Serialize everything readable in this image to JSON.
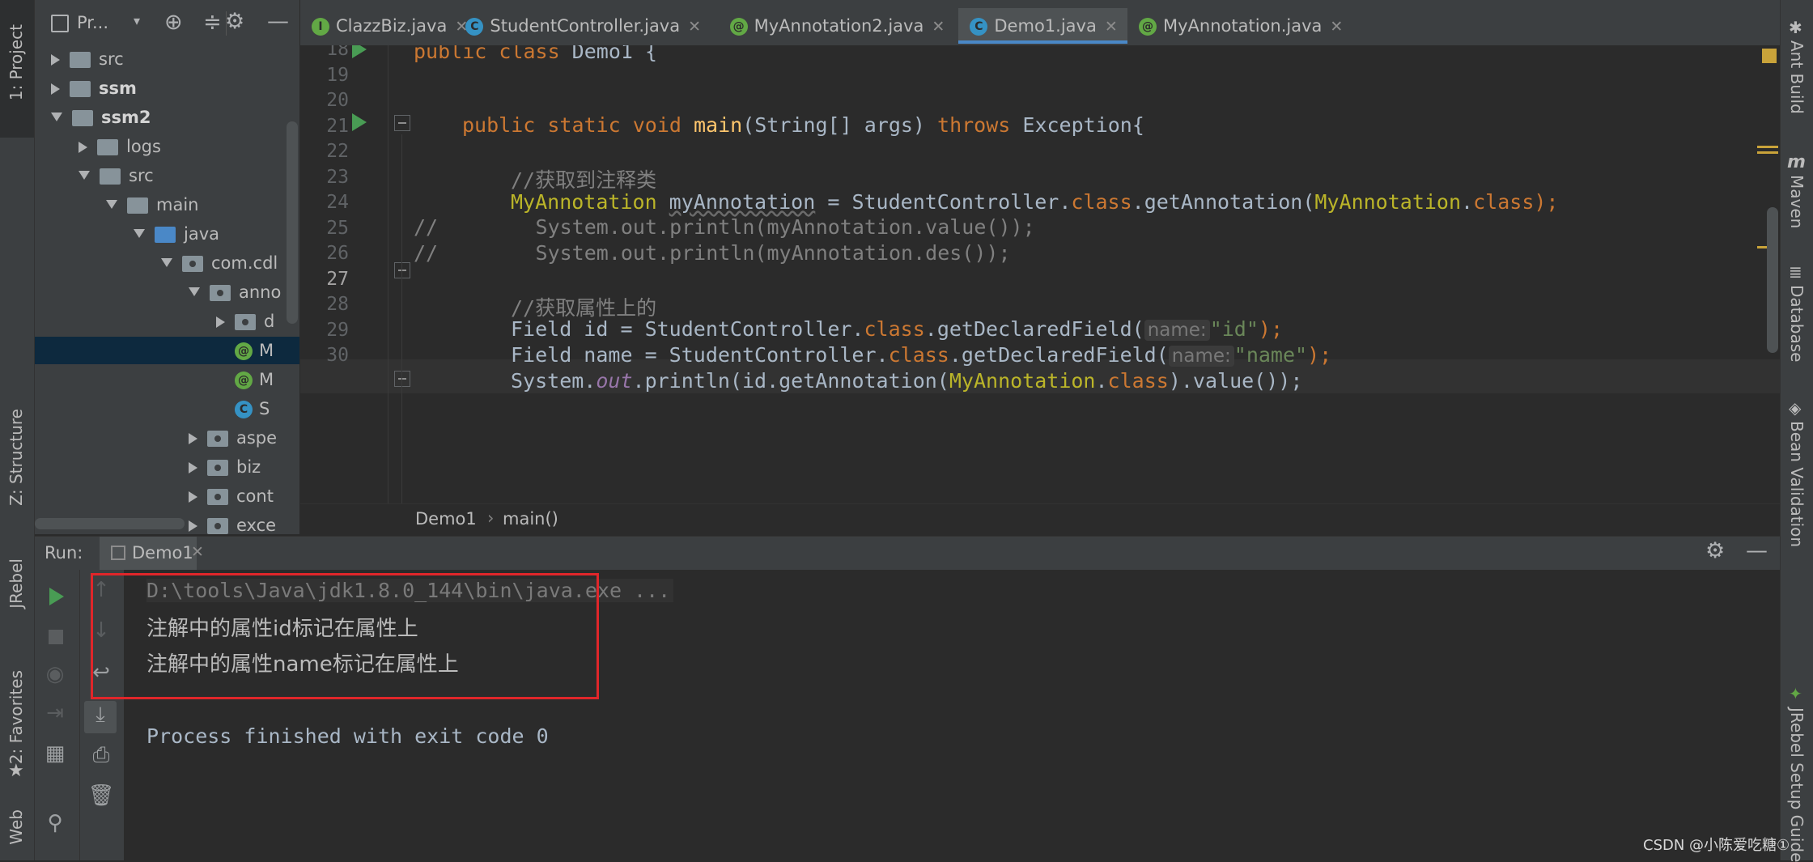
{
  "left_strip": {
    "project": "1: Project",
    "structure": "Z: Structure",
    "jrebel": "JRebel",
    "favorites": "2: Favorites",
    "web": "Web"
  },
  "project_panel": {
    "title": "Pr...",
    "tree": [
      {
        "label": "src",
        "depth": 1,
        "arrow": "right",
        "icon": "folder"
      },
      {
        "label": "ssm",
        "depth": 1,
        "arrow": "right",
        "icon": "folder",
        "bold": true
      },
      {
        "label": "ssm2",
        "depth": 1,
        "arrow": "down",
        "icon": "folder",
        "bold": true
      },
      {
        "label": "logs",
        "depth": 2,
        "arrow": "right",
        "icon": "folder"
      },
      {
        "label": "src",
        "depth": 2,
        "arrow": "down",
        "icon": "folder"
      },
      {
        "label": "main",
        "depth": 3,
        "arrow": "down",
        "icon": "folder"
      },
      {
        "label": "java",
        "depth": 4,
        "arrow": "down",
        "icon": "folder-blue"
      },
      {
        "label": "com.cdl",
        "depth": 5,
        "arrow": "down",
        "icon": "package"
      },
      {
        "label": "anno",
        "depth": 6,
        "arrow": "down",
        "icon": "package"
      },
      {
        "label": "d",
        "depth": 7,
        "arrow": "right",
        "icon": "package"
      },
      {
        "label": "M",
        "depth": 7,
        "arrow": "none",
        "icon": "annotation",
        "selected": true
      },
      {
        "label": "M",
        "depth": 7,
        "arrow": "none",
        "icon": "annotation"
      },
      {
        "label": "S",
        "depth": 7,
        "arrow": "none",
        "icon": "class"
      },
      {
        "label": "aspe",
        "depth": 6,
        "arrow": "right",
        "icon": "package"
      },
      {
        "label": "biz",
        "depth": 6,
        "arrow": "right",
        "icon": "package"
      },
      {
        "label": "cont",
        "depth": 6,
        "arrow": "right",
        "icon": "package"
      },
      {
        "label": "exce",
        "depth": 6,
        "arrow": "right",
        "icon": "package"
      }
    ]
  },
  "tabs": [
    {
      "label": "ClazzBiz.java",
      "icon": "I",
      "kind": "i"
    },
    {
      "label": "StudentController.java",
      "icon": "C",
      "kind": "c"
    },
    {
      "label": "MyAnnotation2.java",
      "icon": "@",
      "kind": "at"
    },
    {
      "label": "Demo1.java",
      "icon": "C",
      "kind": "c",
      "active": true
    },
    {
      "label": "MyAnnotation.java",
      "icon": "@",
      "kind": "at"
    }
  ],
  "editor": {
    "line_numbers": [
      "18",
      "19",
      "20",
      "21",
      "22",
      "23",
      "24",
      "25",
      "26",
      "27",
      "28",
      "29",
      "30"
    ],
    "current_line": "27",
    "lines": {
      "l18": {
        "kw": "public class ",
        "name": "Demo1 {"
      },
      "l20": {
        "kw1": "public static void ",
        "fn": "main",
        "params": "(String[] args) ",
        "kw2": "throws ",
        "rest": "Exception{"
      },
      "l22": {
        "comment": "//获取到注释类"
      },
      "l23": {
        "type": "MyAnnotation ",
        "var": "myAnnotation",
        "eq": " = StudentController.",
        "kw": "class",
        "mid": ".getAnnotation(",
        "arg": "MyAnnotation",
        "dot": ".",
        "kw2": "class",
        "end": ");"
      },
      "l24": {
        "comment": "//        System.out.println(myAnnotation.value());"
      },
      "l25": {
        "comment": "//        System.out.println(myAnnotation.des());"
      },
      "l27": {
        "comment": "//获取属性上的"
      },
      "l28": {
        "pre": "Field id = StudentController.",
        "kw": "class",
        "mid": ".getDeclaredField(",
        "hint": "name:",
        "str": "\"id\"",
        "end": ");"
      },
      "l29": {
        "pre": "Field name = StudentController.",
        "kw": "class",
        "mid": ".getDeclaredField(",
        "hint": "name:",
        "str": "\"name\"",
        "end": ");"
      },
      "l30": {
        "pre": "System.",
        "field": "out",
        "mid": ".println(id.getAnnotation(",
        "arg": "MyAnnotation",
        "dot": ".",
        "kw": "class",
        "end": ").value());"
      }
    }
  },
  "breadcrumb": {
    "items": [
      "Demo1",
      "main()"
    ]
  },
  "run_panel": {
    "label": "Run:",
    "tab": "Demo1",
    "console": [
      "D:\\tools\\Java\\jdk1.8.0_144\\bin\\java.exe ...",
      "注解中的属性id标记在属性上",
      "注解中的属性name标记在属性上",
      "",
      "Process finished with exit code 0"
    ],
    "highlight_color": "#e0262a"
  },
  "right_strip": {
    "ant": "Ant Build",
    "maven": "Maven",
    "database": "Database",
    "bean": "Bean Validation",
    "jrebel_guide": "JRebel Setup Guide"
  },
  "watermark": "CSDN @小陈爱吃糖①"
}
